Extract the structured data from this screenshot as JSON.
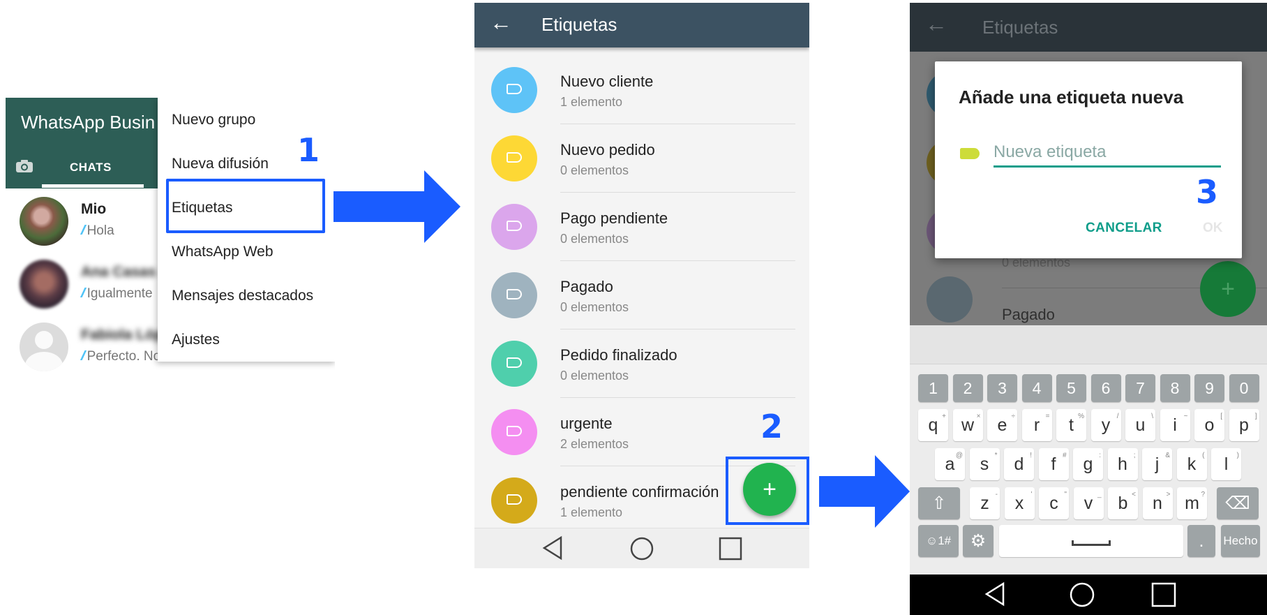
{
  "panel1": {
    "app_title": "WhatsApp Busin",
    "tab_chats": "CHATS",
    "chats": [
      {
        "name": "Mio",
        "message": "Hola",
        "ticks": "//"
      },
      {
        "name": "Ana Casas",
        "message": "Igualmente",
        "ticks": "//"
      },
      {
        "name": "Fabiola López",
        "message": "Perfecto. Nos vemos el martes",
        "ticks": "//"
      }
    ],
    "menu_items": [
      "Nuevo grupo",
      "Nueva difusión",
      "Etiquetas",
      "WhatsApp Web",
      "Mensajes destacados",
      "Ajustes"
    ],
    "step": "1"
  },
  "panel2": {
    "title": "Etiquetas",
    "back_icon": "←",
    "labels": [
      {
        "name": "Nuevo cliente",
        "count": "1 elemento",
        "color": "#5ec3f7"
      },
      {
        "name": "Nuevo pedido",
        "count": "0 elementos",
        "color": "#fdd835"
      },
      {
        "name": "Pago pendiente",
        "count": "0 elementos",
        "color": "#dba6ec"
      },
      {
        "name": "Pagado",
        "count": "0 elementos",
        "color": "#9fb3bf"
      },
      {
        "name": "Pedido finalizado",
        "count": "0 elementos",
        "color": "#4fcfac"
      },
      {
        "name": "urgente",
        "count": "2 elementos",
        "color": "#f48ef1"
      },
      {
        "name": "pendiente confirmación",
        "count": "1 elemento",
        "color": "#d4aa1a"
      }
    ],
    "fab": "+",
    "step": "2"
  },
  "panel3": {
    "title": "Etiquetas",
    "back_icon": "←",
    "dialog_title": "Añade una etiqueta nueva",
    "input_placeholder": "Nueva etiqueta",
    "cancel": "CANCELAR",
    "ok": "OK",
    "bg_count": "0 elementos",
    "bg_label": "Pagado",
    "fab": "+",
    "step": "3",
    "keyboard": {
      "numbers": [
        "1",
        "2",
        "3",
        "4",
        "5",
        "6",
        "7",
        "8",
        "9",
        "0"
      ],
      "row1": [
        "q",
        "w",
        "e",
        "r",
        "t",
        "y",
        "u",
        "i",
        "o",
        "p"
      ],
      "row1_sup": [
        "+",
        "×",
        "÷",
        "=",
        "%",
        "/",
        "\\",
        "~",
        "[",
        "]"
      ],
      "row2": [
        "a",
        "s",
        "d",
        "f",
        "g",
        "h",
        "j",
        "k",
        "l"
      ],
      "row2_sup": [
        "@",
        "*",
        "!",
        "#",
        ":",
        ";",
        "&",
        "(",
        ")"
      ],
      "row3": [
        "z",
        "x",
        "c",
        "v",
        "b",
        "n",
        "m"
      ],
      "row3_sup": [
        "-",
        "'",
        "\"",
        "_",
        "<",
        ">",
        "?"
      ],
      "symbols": "☺1#",
      "done": "Hecho",
      "period": "."
    }
  },
  "colors": {
    "accent_blue": "#1a5cff",
    "whatsapp_green": "#2d5e56",
    "teal": "#0f9d8a",
    "fab_green": "#21b34f"
  }
}
